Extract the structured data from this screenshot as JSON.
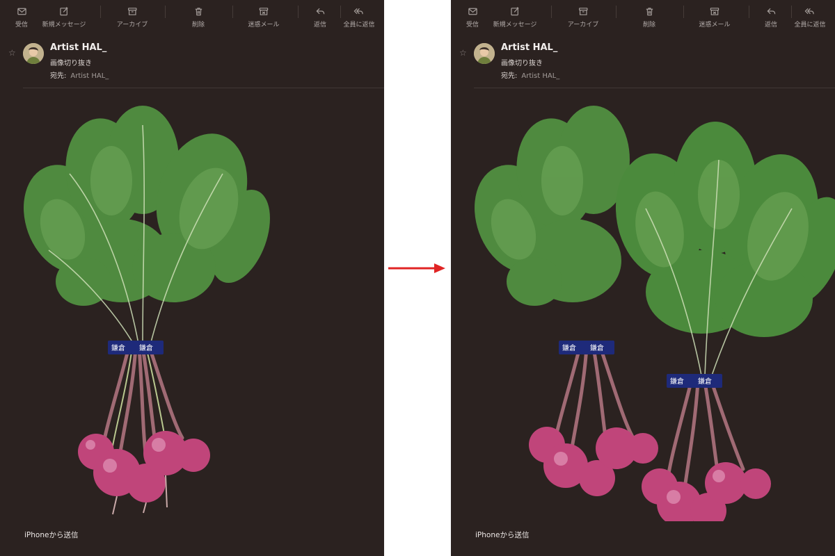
{
  "toolbar": {
    "items": [
      {
        "label": "受信",
        "icon": "inbox-icon"
      },
      {
        "label": "新規メッセージ",
        "icon": "compose-icon"
      },
      {
        "label": "アーカイブ",
        "icon": "archive-icon"
      },
      {
        "label": "削除",
        "icon": "trash-icon"
      },
      {
        "label": "迷惑メール",
        "icon": "junk-icon"
      },
      {
        "label": "返信",
        "icon": "reply-icon"
      },
      {
        "label": "全員に返信",
        "icon": "reply-all-icon"
      }
    ]
  },
  "message": {
    "sender": "Artist HAL_",
    "subject": "画像切り抜き",
    "to_label": "宛先:",
    "to_value": "Artist HAL_",
    "footer": "iPhoneから送信"
  },
  "colors": {
    "panel_bg": "#2b2220",
    "arrow": "#e02424",
    "leaf": "#4f8a3f",
    "radish": "#c0457a",
    "band": "#1e2a7a"
  },
  "image_content": {
    "left": "single bunch of radishes",
    "right": "two bunches of radishes"
  }
}
